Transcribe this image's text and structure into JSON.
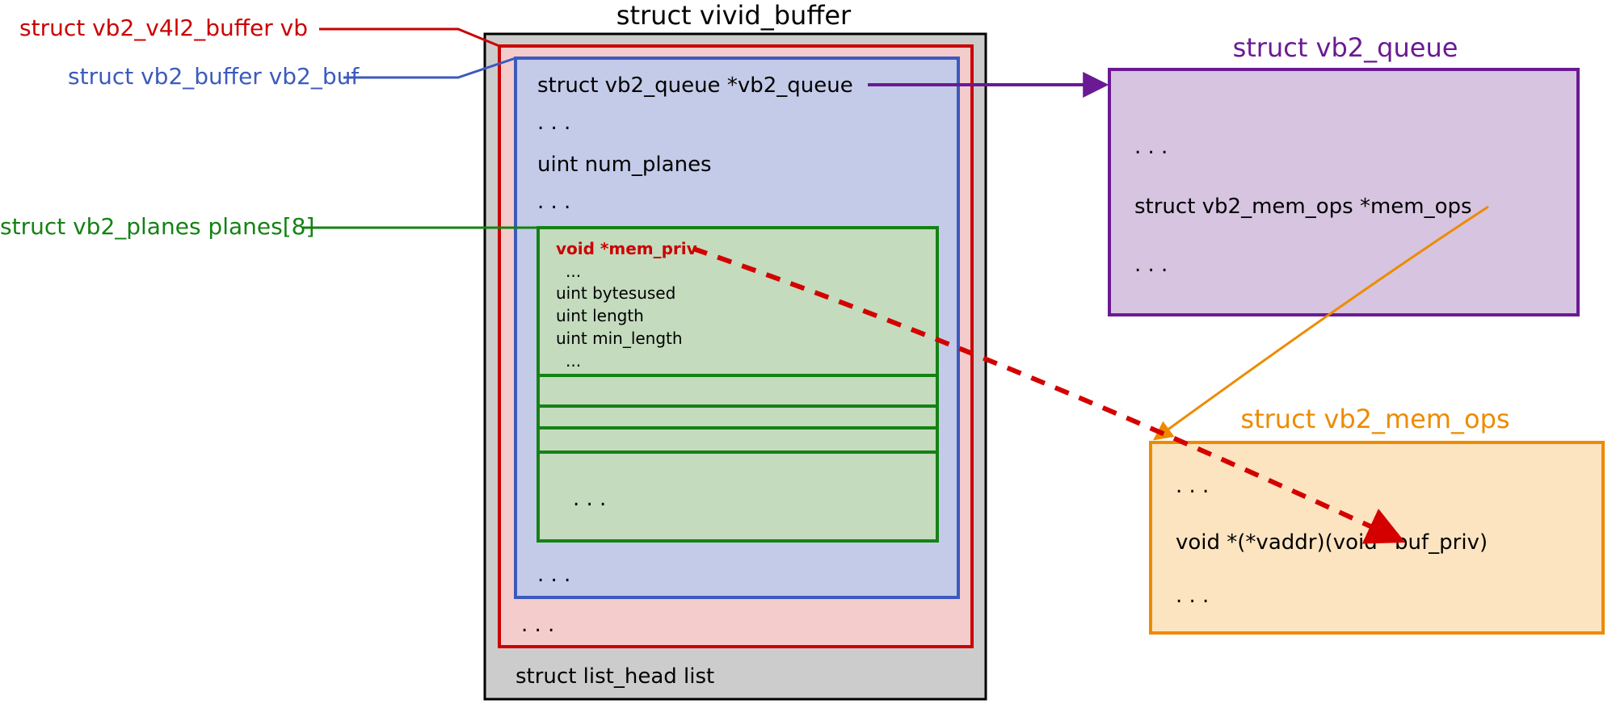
{
  "colors": {
    "gray_fill": "#cccccc",
    "gray_stroke": "#000000",
    "red_stroke": "#cc0000",
    "red_fill": "#f4cccc",
    "blue_stroke": "#3c5abe",
    "blue_fill": "#c3cbe8",
    "green_stroke": "#148214",
    "green_fill": "#c4dbbe",
    "purple_stroke": "#6a1a93",
    "purple_fill": "#d6c4e0",
    "orange_stroke": "#ed8b00",
    "orange_fill": "#fde4c0",
    "dashed_red": "#d40000"
  },
  "vivid": {
    "title": "struct vivid_buffer",
    "list_head": "struct list_head list"
  },
  "vb": {
    "label": "struct vb2_v4l2_buffer vb",
    "dots": ". . ."
  },
  "vb2buf": {
    "label": "struct vb2_buffer vb2_buf",
    "field1": "struct vb2_queue *vb2_queue",
    "dots1": ". . .",
    "field2": "uint num_planes",
    "dots2": ". . .",
    "dots3": ". . ."
  },
  "planes": {
    "label": "struct vb2_planes planes[8]",
    "mem_priv": "void *mem_priv",
    "dots1": "...",
    "bytesused": "uint bytesused",
    "length": "uint length",
    "min_length": "uint min_length",
    "dots2": "...",
    "more": ". . ."
  },
  "queue": {
    "title": "struct vb2_queue",
    "dots1": ". . .",
    "mem_ops": "struct vb2_mem_ops *mem_ops",
    "dots2": ". . ."
  },
  "memops": {
    "title": "struct vb2_mem_ops",
    "dots1": ". . .",
    "vaddr": "void *(*vaddr)(void *buf_priv)",
    "dots2": ". . ."
  }
}
